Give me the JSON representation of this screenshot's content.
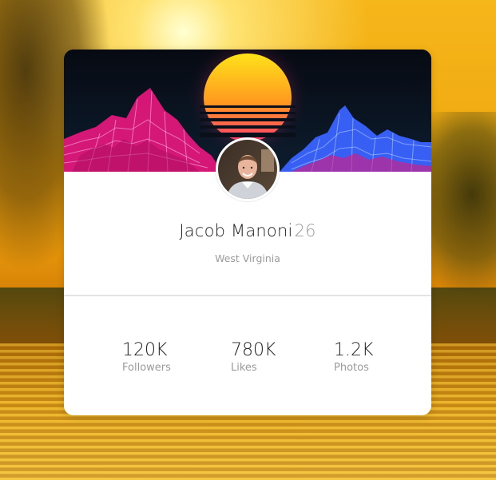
{
  "profile": {
    "name": "Jacob Manoni",
    "age": "26",
    "location": "West Virginia"
  },
  "stats": [
    {
      "value": "120K",
      "label": "Followers"
    },
    {
      "value": "780K",
      "label": "Likes"
    },
    {
      "value": "1.2K",
      "label": "Photos"
    }
  ],
  "colors": {
    "card_bg": "#ffffff",
    "banner_bg": "#0b0f1a",
    "sun_top": "#ffe21a",
    "sun_bottom": "#ff3f6d",
    "mountain_left": "#e0177b",
    "mountain_right": "#3b63ff"
  },
  "icons": {
    "banner": "synthwave-sunset-banner",
    "avatar": "profile-photo"
  }
}
